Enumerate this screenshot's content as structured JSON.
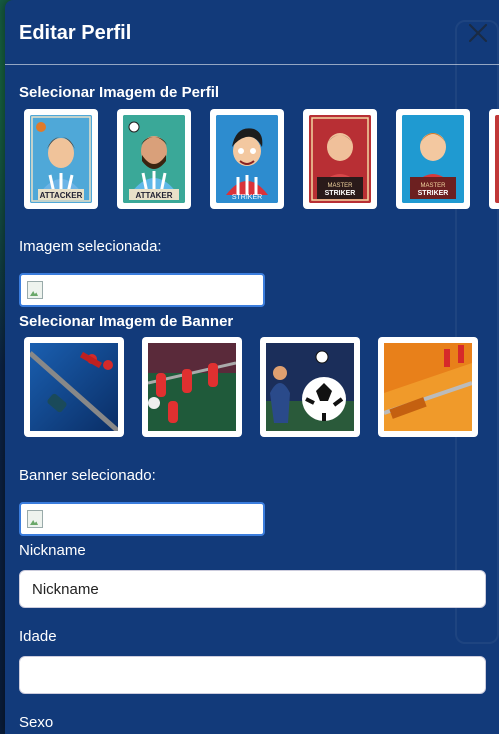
{
  "modal": {
    "title": "Editar Perfil",
    "close_icon": "close-icon"
  },
  "profile_section": {
    "label": "Selecionar Imagem de Perfil",
    "images": [
      {
        "caption": "ATTACKER",
        "bg": "#4fa8d8",
        "shirt": "#6cb4e6",
        "hair": "#5a3318"
      },
      {
        "caption": "ATTAKER",
        "bg": "#2f9a8a",
        "shirt": "#5fb8e8",
        "hair": "#3a2410"
      },
      {
        "caption": "STRIKER",
        "bg": "#2d8ccf",
        "shirt": "#d9323a",
        "hair": "#1d1d1d"
      },
      {
        "caption": "STRIKER",
        "bg": "#c8363a",
        "shirt": "#c8363a",
        "hair": "#3a1a10"
      },
      {
        "caption": "STRIKER",
        "bg": "#1f9ad1",
        "shirt": "#d63a3a",
        "hair": "#d07a2a"
      },
      {
        "caption": "",
        "bg": "#c03838",
        "shirt": "#c03838",
        "hair": "#333"
      }
    ],
    "selected_label": "Imagem selecionada:"
  },
  "banner_section": {
    "label": "Selecionar Imagem de Banner",
    "images": [
      {
        "name": "foosball-blue"
      },
      {
        "name": "foosball-red-green"
      },
      {
        "name": "soccer-ball-action"
      },
      {
        "name": "foosball-orange"
      }
    ],
    "selected_label": "Banner selecionado:"
  },
  "form": {
    "nickname_label": "Nickname",
    "nickname_placeholder": "Nickname",
    "idade_label": "Idade",
    "idade_value": "",
    "sexo_label": "Sexo"
  },
  "colors": {
    "modal_bg": "#123a7a",
    "selected_border": "#3b7ddd"
  }
}
